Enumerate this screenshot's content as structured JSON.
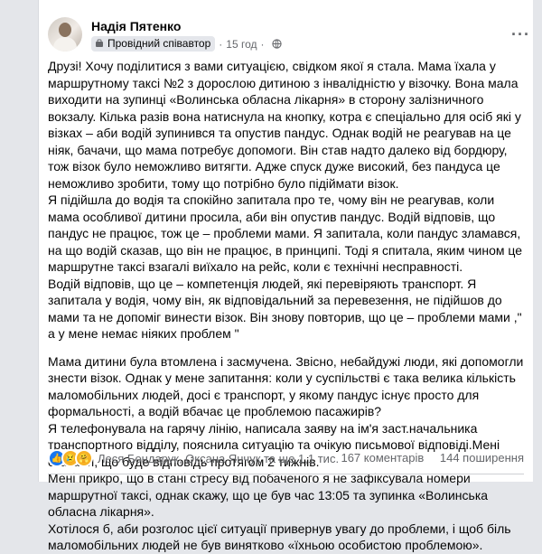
{
  "post": {
    "author": "Надія Пятенко",
    "badge": "Провідний співавтор",
    "time": "15 год",
    "privacy_icon": "globe-icon",
    "menu_icon": "more-icon",
    "paragraphs": [
      "Друзі! Хочу поділитися з вами ситуацією, свідком якої я стала. Мама їхала у маршрутному таксі №2 з дорослою дитиною з інвалідністю у візочку. Вона мала виходити на зупинці «Волинська обласна лікарня» в сторону залізничного вокзалу. Кілька разів вона натиснула на кнопку, котра є спеціально для осіб які  у візках – аби водій зупинився та опустив пандус. Однак водій не реагував на це ніяк, бачачи, що мама потребує допомоги. Він став надто далеко від бордюру, тож візок було неможливо витягти. Адже спуск дуже високий, без пандуса це неможливо зробити, тому що потрібно було підіймати візок.\nЯ підійшла до водія та спокійно запитала про те, чому він не реагував, коли мама особливої дитини просила, аби він опустив пандус. Водій відповів, що пандус не працює, тож це – проблеми мами. Я запитала, коли пандус зламався, на що водій сказав, що він не працює, в принципі. Тоді я спитала, яким чином це маршрутне таксі взагалі виїхало на рейс, коли є технічні несправності.\nВодій відповів, що це – компетенція людей, які перевіряють транспорт. Я запитала у водія, чому він, як відповідальний за перевезення, не підійшов до мами та не допоміг винести візок. Він знову повторив, що це – проблеми мами ,\" а у мене немає ніяких проблем \"",
      "Мама дитини була втомлена і засмучена.   Звісно, небайдужі  люди, які допомогли знести візок. Однак у мене запитання: коли у суспільстві є така велика кількість маломобільних людей, досі є транспорт, у якому пандус існує просто для формальності, а водій вбачає це проблемою пасажирів?\nЯ телефонувала на гарячу лінію, написала заяву на ім'я заст.начальника транспортного відділу, пояснила ситуацію та очікую письмової відповіді.Мені сказали, що буде відповідь протягом 2 тижнів.\nМені прикро, що в стані стресу від побаченого я не зафіксувала номери маршрутної таксі, однак скажу, що це був час 13:05 та зупинка «Волинська обласна лікарня».\nХотілося б, аби розголос цієї ситуації привернув увагу до проблеми, і щоб біль маломобільних людей не був винятково «їхньою особистою проблемою»."
    ],
    "reactions_text": "Леся Бондарук, Оксана Янчук та ще 1,1 тис.",
    "comments": "167 коментарів",
    "shares": "144 поширення"
  }
}
